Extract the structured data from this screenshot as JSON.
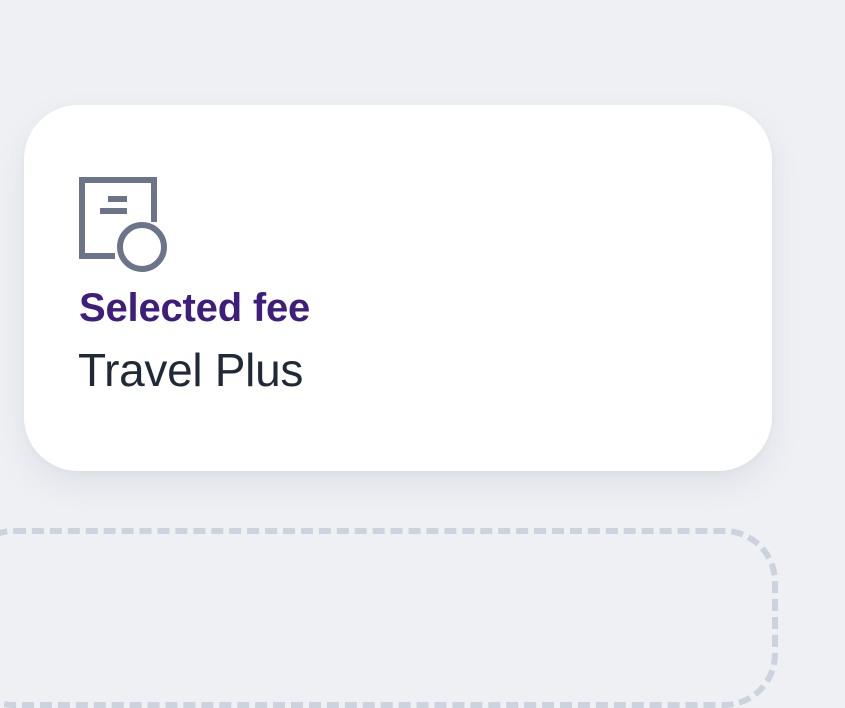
{
  "fee_card": {
    "icon": "fee-document-icon",
    "label": "Selected fee",
    "value": "Travel Plus"
  },
  "colors": {
    "background": "#eef0f4",
    "card": "#ffffff",
    "label": "#3f1d7a",
    "value": "#1f2937",
    "icon": "#6b7489",
    "dashed_border": "#ccd2de"
  }
}
